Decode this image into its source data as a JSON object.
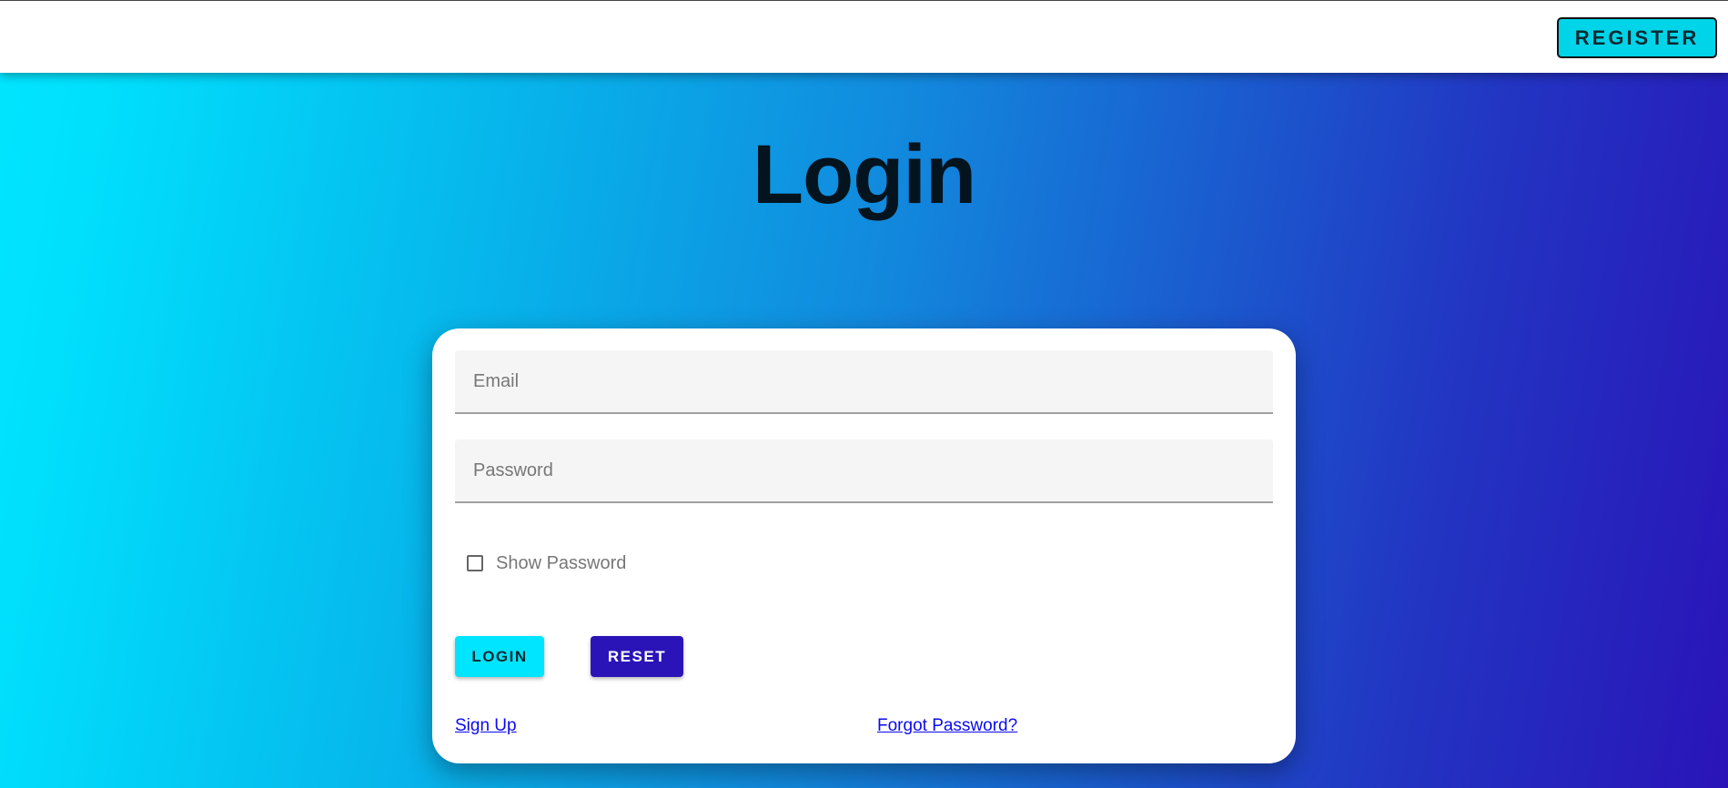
{
  "header": {
    "register_label": "REGISTER"
  },
  "page": {
    "title": "Login"
  },
  "form": {
    "email_placeholder": "Email",
    "email_value": "",
    "password_placeholder": "Password",
    "password_value": "",
    "show_password_label": "Show Password",
    "show_password_checked": false,
    "login_label": "LOGIN",
    "reset_label": "RESET",
    "signup_link": "Sign Up",
    "forgot_link": "Forgot Password?"
  },
  "colors": {
    "accent_cyan": "#00e5ff",
    "accent_indigo": "#2a14b8",
    "link": "#0b0bee",
    "title": "#04141e"
  }
}
